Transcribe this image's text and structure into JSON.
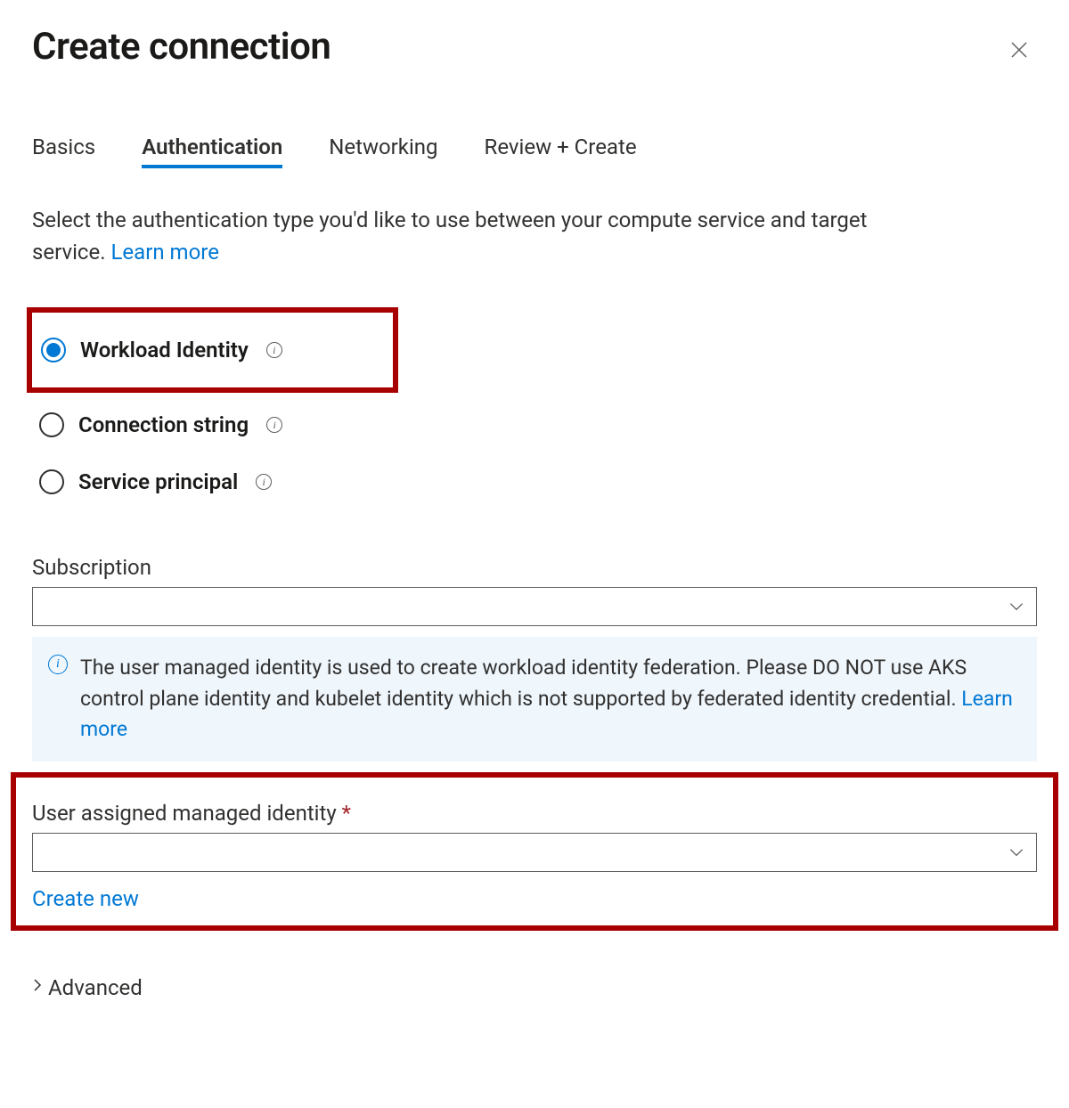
{
  "header": {
    "title": "Create connection"
  },
  "tabs": [
    {
      "label": "Basics",
      "active": false
    },
    {
      "label": "Authentication",
      "active": true
    },
    {
      "label": "Networking",
      "active": false
    },
    {
      "label": "Review + Create",
      "active": false
    }
  ],
  "intro": {
    "text": "Select the authentication type you'd like to use between your compute service and target service. ",
    "learn_more_label": "Learn more"
  },
  "auth_options": [
    {
      "label": "Workload Identity",
      "selected": true,
      "highlighted": true
    },
    {
      "label": "Connection string",
      "selected": false,
      "highlighted": false
    },
    {
      "label": "Service principal",
      "selected": false,
      "highlighted": false
    }
  ],
  "subscription_field": {
    "label": "Subscription",
    "value": ""
  },
  "info_box": {
    "text": "The user managed identity is used to create workload identity federation. Please DO NOT use AKS control plane identity and kubelet identity which is not supported by federated identity credential. ",
    "learn_more_label": "Learn more"
  },
  "identity_field": {
    "label": "User assigned managed identity ",
    "required_mark": "*",
    "value": "",
    "create_new_label": "Create new"
  },
  "advanced": {
    "label": "Advanced"
  }
}
